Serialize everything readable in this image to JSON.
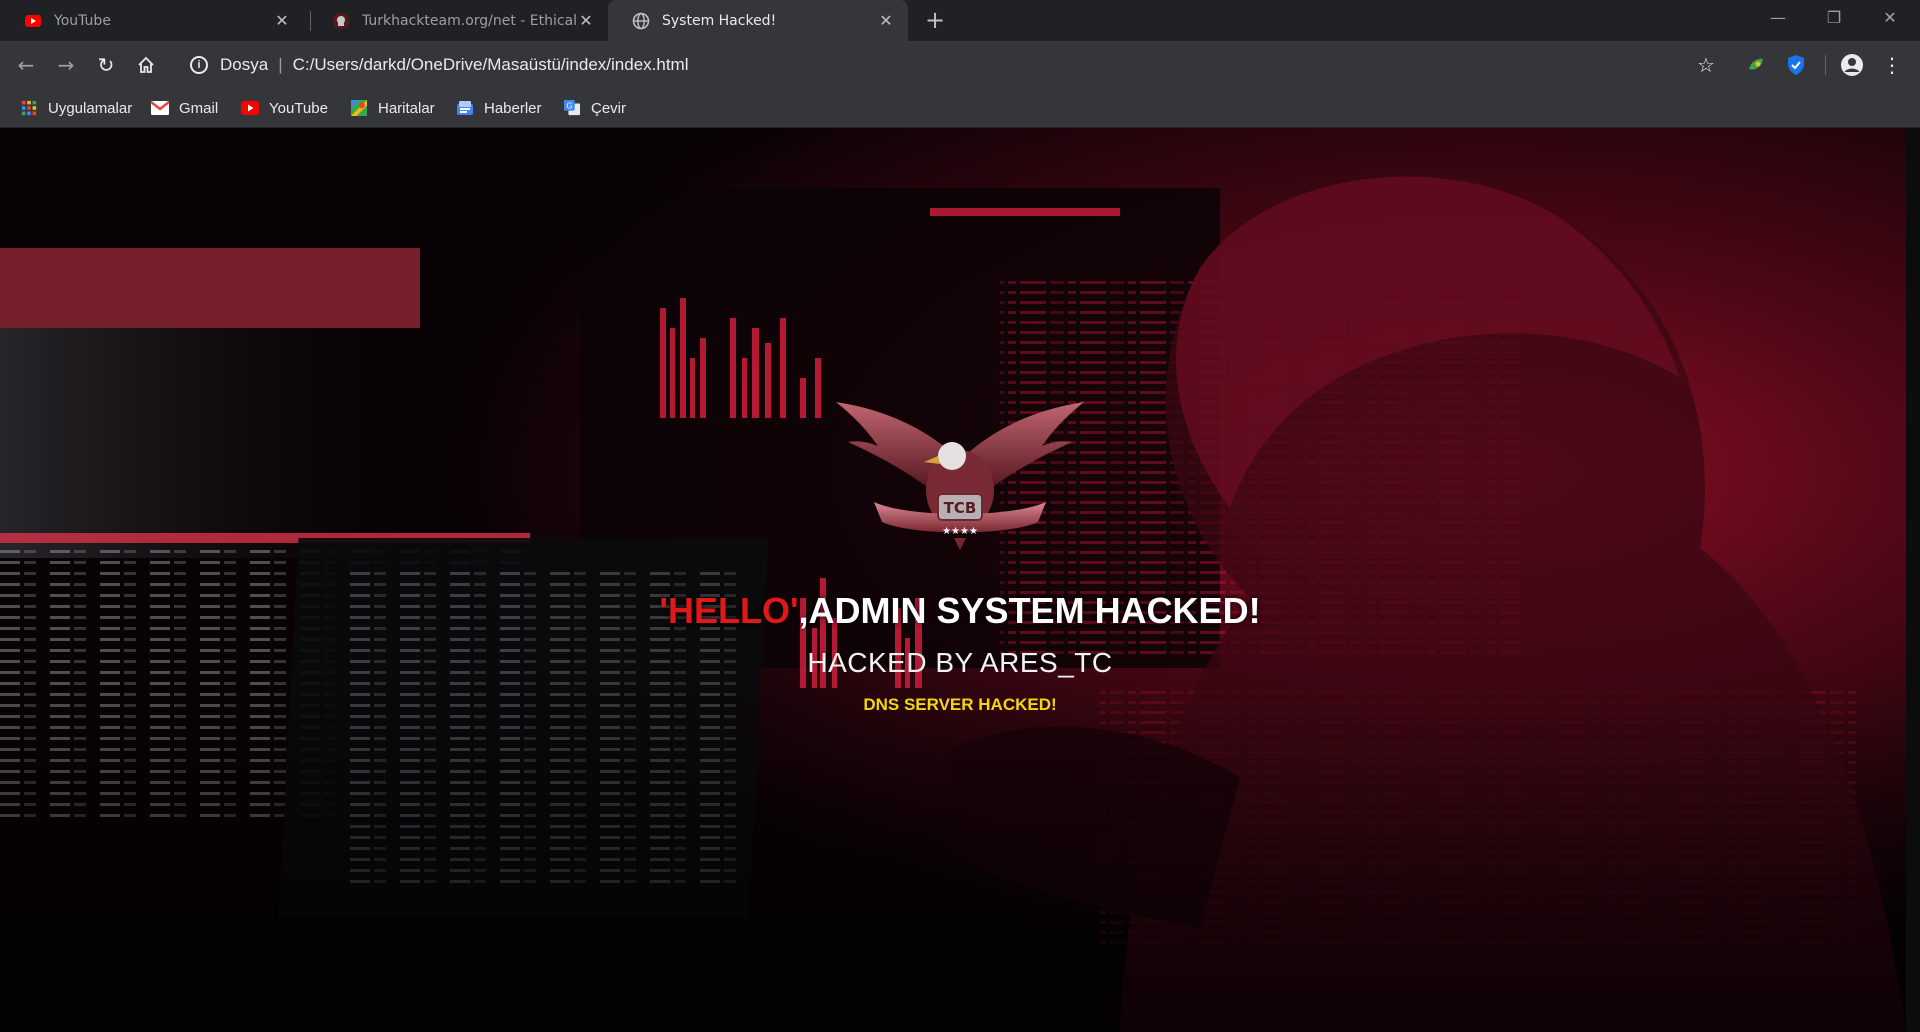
{
  "tabs": [
    {
      "title": "YouTube",
      "favicon": "youtube-icon",
      "active": false
    },
    {
      "title": "Turkhackteam.org/net - Ethical H",
      "favicon": "turkhackteam-icon",
      "active": false
    },
    {
      "title": "System Hacked!",
      "favicon": "globe-icon",
      "active": true
    }
  ],
  "window_controls": {
    "minimize": "—",
    "restore": "❐",
    "close": "✕"
  },
  "toolbar": {
    "scheme_label": "Dosya",
    "separator": "|",
    "url": "C:/Users/darkd/OneDrive/Masaüstü/index/index.html"
  },
  "bookmarks": [
    {
      "label": "Uygulamalar",
      "icon": "apps-grid-icon"
    },
    {
      "label": "Gmail",
      "icon": "gmail-icon"
    },
    {
      "label": "YouTube",
      "icon": "youtube-icon"
    },
    {
      "label": "Haritalar",
      "icon": "maps-icon"
    },
    {
      "label": "Haberler",
      "icon": "news-icon"
    },
    {
      "label": "Çevir",
      "icon": "translate-icon"
    }
  ],
  "page": {
    "emblem_text": "TCB",
    "headline_red": "'HELLO'",
    "headline_rest": ",ADMIN SYSTEM HACKED!",
    "subtitle": "HACKED BY ARES_TC",
    "subtitle2": "DNS SERVER HACKED!"
  },
  "colors": {
    "headline_accent": "#e01818",
    "subtitle2": "#f5d60a",
    "chrome_dark": "#202124",
    "chrome_toolbar": "#35363a"
  }
}
